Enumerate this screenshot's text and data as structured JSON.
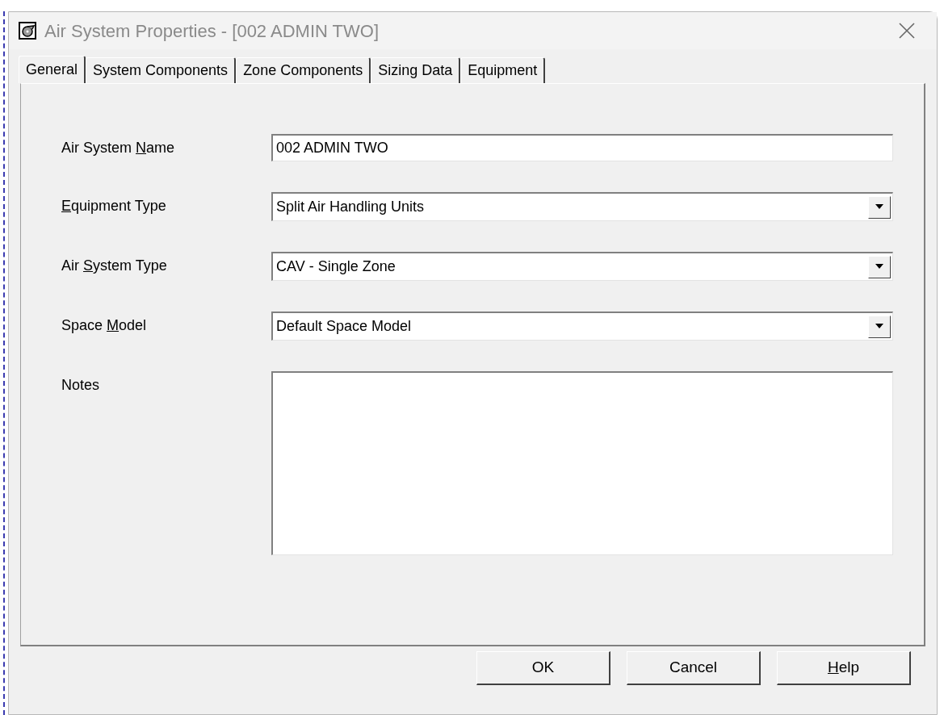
{
  "window": {
    "title": "Air System Properties - [002 ADMIN TWO]"
  },
  "tabs": [
    {
      "label": "General",
      "selected": true
    },
    {
      "label": "System Components",
      "selected": false
    },
    {
      "label": "Zone Components",
      "selected": false
    },
    {
      "label": "Sizing Data",
      "selected": false
    },
    {
      "label": "Equipment",
      "selected": false
    }
  ],
  "fields": [
    {
      "kind": "text",
      "label_before": "Air System ",
      "access_key": "N",
      "label_after": "ame",
      "value": "002 ADMIN TWO"
    },
    {
      "kind": "dropdown",
      "access_key": "E",
      "label_after": "quipment Type",
      "value": "Split Air Handling Units"
    },
    {
      "kind": "dropdown",
      "label_before": "Air ",
      "access_key": "S",
      "label_after": "ystem Type",
      "value": "CAV - Single Zone"
    },
    {
      "kind": "dropdown",
      "label_before": "Space ",
      "access_key": "M",
      "label_after": "odel",
      "value": "Default Space Model"
    },
    {
      "kind": "memo",
      "label_before": "Notes"
    }
  ],
  "buttons": [
    {
      "label_before": "OK"
    },
    {
      "label_before": "Cancel"
    },
    {
      "access_key": "H",
      "label_after": "elp"
    }
  ]
}
